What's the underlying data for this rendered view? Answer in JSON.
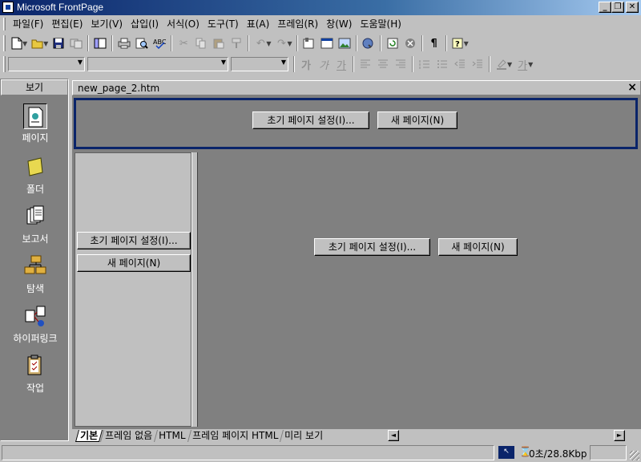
{
  "window": {
    "title": "Microsoft FrontPage",
    "minimize": "_",
    "restore": "❐",
    "close": "✕"
  },
  "menu": [
    "파일(F)",
    "편집(E)",
    "보기(V)",
    "삽입(I)",
    "서식(O)",
    "도구(T)",
    "표(A)",
    "프레임(R)",
    "창(W)",
    "도움말(H)"
  ],
  "toolbar2": {
    "bold_glyph": "가",
    "italic_glyph": "가",
    "underline_glyph": "가",
    "fontcolor_glyph": "가"
  },
  "viewbar": {
    "header": "보기",
    "items": [
      "페이지",
      "폴더",
      "보고서",
      "탐색",
      "하이퍼링크",
      "작업"
    ]
  },
  "document": {
    "tab_title": "new_page_2.htm",
    "close": "×"
  },
  "frames": {
    "top": {
      "init_button": "초기 페이지 설정(I)...",
      "new_button": "새 페이지(N)"
    },
    "left": {
      "init_button": "초기 페이지 설정(I)...",
      "new_button": "새 페이지(N)"
    },
    "main": {
      "init_button": "초기 페이지 설정(I)...",
      "new_button": "새 페이지(N)"
    }
  },
  "view_tabs": [
    "기본",
    "프레임 없음",
    "HTML",
    "프레임 페이지 HTML",
    "미리 보기"
  ],
  "statusbar": {
    "icon": "↖",
    "hourglass": "⌛",
    "connection": "0초/28.8Kbp"
  },
  "colors": {
    "title_gradient_start": "#0a246a",
    "frame_selected_border": "#0a246a",
    "workspace": "#808080",
    "face": "#c0c0c0"
  }
}
